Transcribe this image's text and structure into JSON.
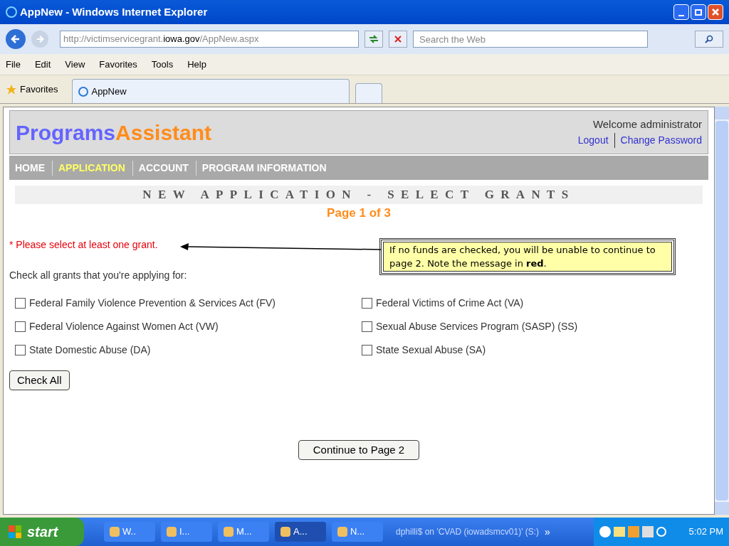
{
  "window": {
    "title": "AppNew - Windows Internet Explorer"
  },
  "address_bar": {
    "url_prefix": "http://victimservicegrant.",
    "url_domain": "iowa.gov",
    "url_path": "/AppNew.aspx"
  },
  "search": {
    "placeholder": "Search the Web"
  },
  "menu": [
    "File",
    "Edit",
    "View",
    "Favorites",
    "Tools",
    "Help"
  ],
  "favorites_bar": {
    "label": "Favorites",
    "tab": "AppNew"
  },
  "header": {
    "logo_first": "Programs",
    "logo_second": "Assistant",
    "welcome": "Welcome administrator",
    "links": [
      "Logout",
      "Change Password"
    ]
  },
  "nav": [
    {
      "label": "HOME",
      "selected": false
    },
    {
      "label": "APPLICATION",
      "selected": true
    },
    {
      "label": "ACCOUNT",
      "selected": false
    },
    {
      "label": "PROGRAM INFORMATION",
      "selected": false
    }
  ],
  "page_title": "NEW APPLICATION - SELECT GRANTS",
  "page_indicator": "Page 1 of 3",
  "error": "* Please select at least one grant.",
  "instructions": "Check all grants that you're applying for:",
  "grants": [
    {
      "label": "Federal Family Violence Prevention & Services Act (FV)",
      "checked": false
    },
    {
      "label": "Federal Victims of Crime Act (VA)",
      "checked": false
    },
    {
      "label": "Federal Violence Against Women Act (VW)",
      "checked": false
    },
    {
      "label": "Sexual Abuse Services Program (SASP) (SS)",
      "checked": false
    },
    {
      "label": "State Domestic Abuse (DA)",
      "checked": false
    },
    {
      "label": "State Sexual Abuse (SA)",
      "checked": false
    }
  ],
  "check_all_button": "Check All",
  "continue_button": "Continue to Page 2",
  "callout": "If no funds are checked, you will be unable to continue to page 2.  Note the message in **red**.",
  "taskbar": {
    "start": "start",
    "items": [
      {
        "label": "W..",
        "selected": false
      },
      {
        "label": "I...",
        "selected": false
      },
      {
        "label": "M...",
        "selected": false
      },
      {
        "label": "A...",
        "selected": true
      },
      {
        "label": "N...",
        "selected": false
      }
    ],
    "status": "dphilli$ on 'CVAD (iowadsmcv01)' (S:)",
    "more": "»",
    "time": "5:02 PM"
  }
}
